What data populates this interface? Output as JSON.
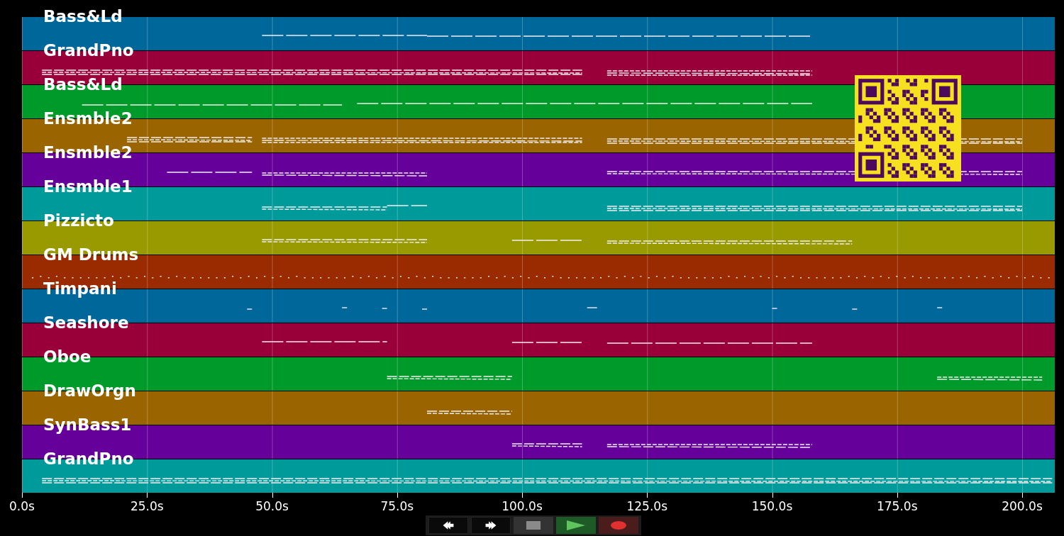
{
  "tracks": [
    {
      "name": "Bass&Ld",
      "color": "#00679a"
    },
    {
      "name": "GrandPno",
      "color": "#99003a"
    },
    {
      "name": "Bass&Ld",
      "color": "#009a2a"
    },
    {
      "name": "Ensmble2",
      "color": "#9a6400"
    },
    {
      "name": "Ensmble2",
      "color": "#66009a"
    },
    {
      "name": "Ensmble1",
      "color": "#009a9a"
    },
    {
      "name": "Pizzicto",
      "color": "#999a00"
    },
    {
      "name": "GM Drums",
      "color": "#9a2a00"
    },
    {
      "name": "Timpani",
      "color": "#00679a"
    },
    {
      "name": "Seashore",
      "color": "#99003a"
    },
    {
      "name": "Oboe",
      "color": "#009a2a"
    },
    {
      "name": "DrawOrgn",
      "color": "#9a6400"
    },
    {
      "name": "SynBass1",
      "color": "#66009a"
    },
    {
      "name": "GrandPno",
      "color": "#009a9a"
    }
  ],
  "time_axis": {
    "ticks": [
      "0.0s",
      "25.0s",
      "50.0s",
      "75.0s",
      "100.0s",
      "125.0s",
      "150.0s",
      "175.0s",
      "200.0s"
    ]
  },
  "transport": [
    {
      "kind": "rewind"
    },
    {
      "kind": "forward"
    },
    {
      "kind": "stop"
    },
    {
      "kind": "play"
    },
    {
      "kind": "record"
    }
  ]
}
